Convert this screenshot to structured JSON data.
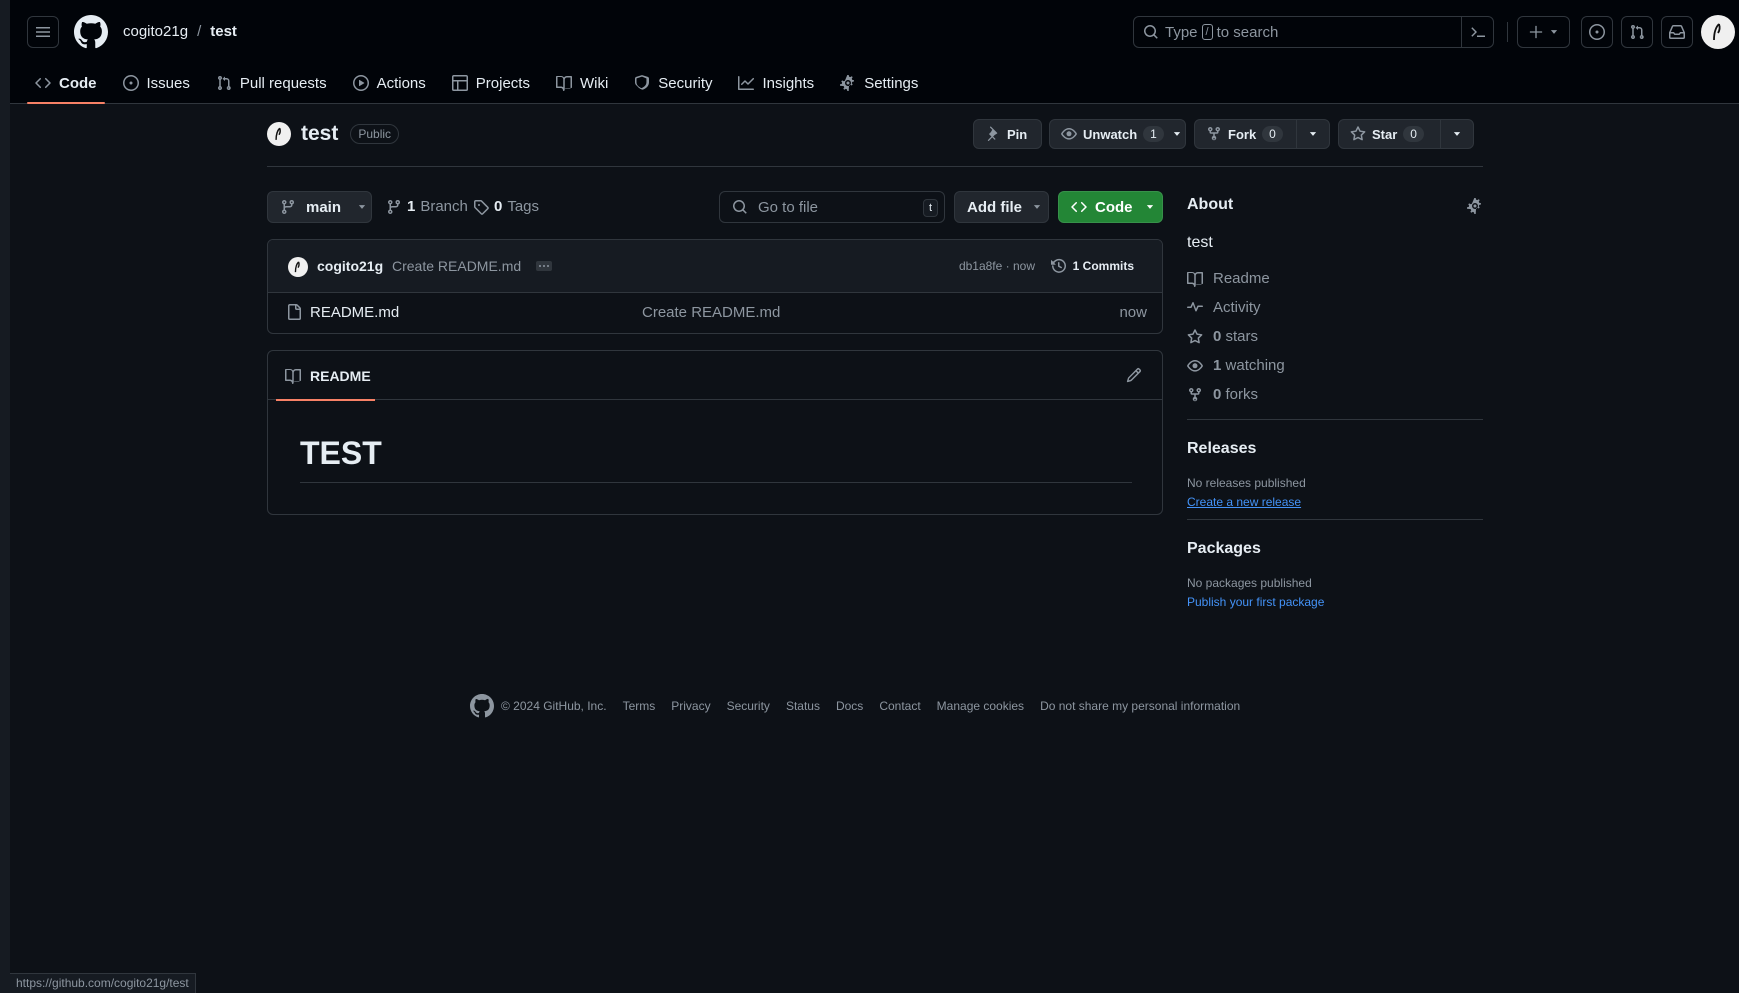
{
  "header": {
    "owner": "cogito21g",
    "separator": "/",
    "repo": "test",
    "search_prefix": "Type",
    "search_key": "/",
    "search_suffix": "to search"
  },
  "tabs": [
    {
      "label": "Code",
      "icon": "code-icon",
      "active": true
    },
    {
      "label": "Issues",
      "icon": "issue-icon"
    },
    {
      "label": "Pull requests",
      "icon": "pull-request-icon"
    },
    {
      "label": "Actions",
      "icon": "play-icon"
    },
    {
      "label": "Projects",
      "icon": "table-icon"
    },
    {
      "label": "Wiki",
      "icon": "book-icon"
    },
    {
      "label": "Security",
      "icon": "shield-icon"
    },
    {
      "label": "Insights",
      "icon": "graph-icon"
    },
    {
      "label": "Settings",
      "icon": "gear-icon"
    }
  ],
  "repo": {
    "name": "test",
    "visibility": "Public",
    "pin_label": "Pin",
    "unwatch_label": "Unwatch",
    "watch_count": "1",
    "fork_label": "Fork",
    "fork_count": "0",
    "star_label": "Star",
    "star_count": "0"
  },
  "filenav": {
    "branch": "main",
    "branch_count": "1",
    "branch_label": "Branch",
    "tag_count": "0",
    "tag_label": "Tags",
    "goto_placeholder": "Go to file",
    "goto_key": "t",
    "add_file_label": "Add file",
    "code_label": "Code"
  },
  "commit": {
    "author": "cogito21g",
    "message": "Create README.md",
    "meta": "db1a8fe · now",
    "commits_label": "1 Commits"
  },
  "files": [
    {
      "name": "README.md",
      "commit": "Create README.md",
      "time": "now"
    }
  ],
  "readme": {
    "tab_label": "README",
    "heading": "TEST"
  },
  "about": {
    "title": "About",
    "description": "test",
    "items": [
      {
        "icon": "book-icon",
        "bold": "",
        "label": "Readme"
      },
      {
        "icon": "pulse-icon",
        "bold": "",
        "label": "Activity"
      },
      {
        "icon": "star-icon",
        "bold": "0",
        "label": "stars"
      },
      {
        "icon": "eye-icon",
        "bold": "1",
        "label": "watching"
      },
      {
        "icon": "fork-icon",
        "bold": "0",
        "label": "forks"
      }
    ]
  },
  "releases": {
    "title": "Releases",
    "note": "No releases published",
    "link": "Create a new release"
  },
  "packages": {
    "title": "Packages",
    "note": "No packages published",
    "link": "Publish your first package"
  },
  "footer": {
    "copyright": "© 2024 GitHub, Inc.",
    "links": [
      "Terms",
      "Privacy",
      "Security",
      "Status",
      "Docs",
      "Contact",
      "Manage cookies",
      "Do not share my personal information"
    ]
  },
  "status_url": "https://github.com/cogito21g/test",
  "colors": {
    "background": "#0d1117",
    "accent_green": "#238636",
    "link_blue": "#4493f8",
    "tab_underline": "#f78166"
  }
}
